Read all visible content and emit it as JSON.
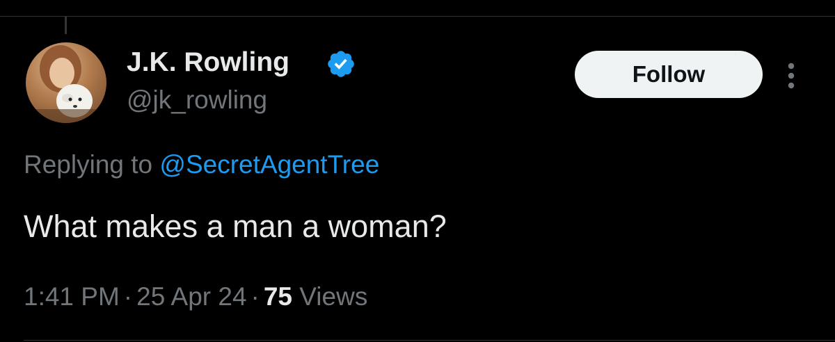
{
  "tweet": {
    "author_name": "J.K. Rowling",
    "author_handle": "@jk_rowling",
    "verified": true,
    "follow_label": "Follow",
    "reply_prefix": "Replying to ",
    "reply_to_handle": "@SecretAgentTree",
    "text": "What makes a man a woman?",
    "time": "1:41 PM",
    "separator": "·",
    "date": "25 Apr 24",
    "views_count": "75",
    "views_label": "Views"
  },
  "icons": {
    "verified": "verified-badge-icon",
    "more": "more-vertical-icon"
  },
  "colors": {
    "background": "#000000",
    "text_primary": "#e7e9ea",
    "text_secondary": "#71767b",
    "accent": "#1d9bf0",
    "follow_button_bg": "#eff3f4",
    "follow_button_text": "#0f1419"
  }
}
